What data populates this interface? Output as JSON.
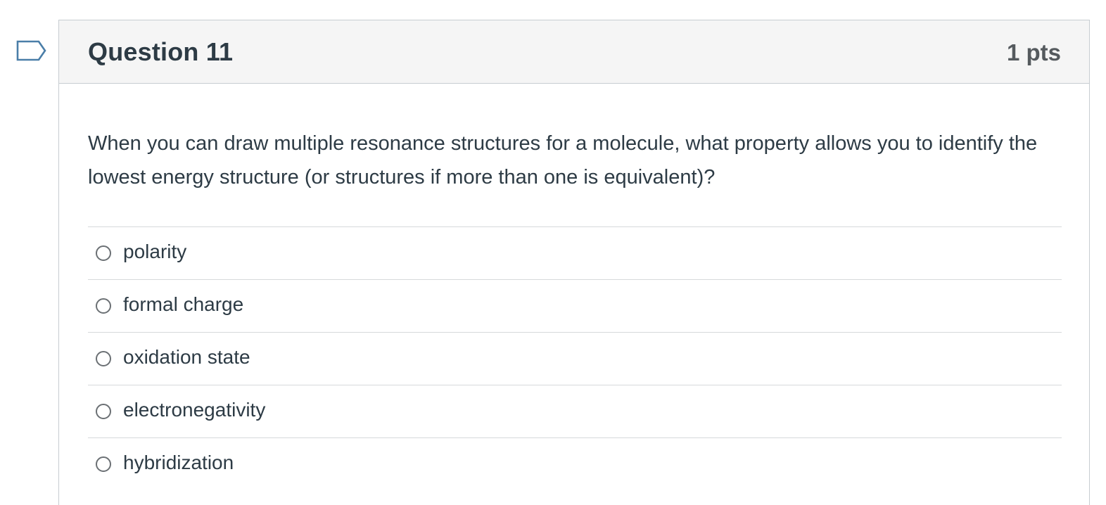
{
  "question": {
    "title": "Question 11",
    "points": "1 pts",
    "text": "When you can draw multiple resonance structures for a molecule, what property allows you to identify the lowest energy structure (or structures if more than one is equivalent)?",
    "flag_icon": "bookmark-flag-icon"
  },
  "answers": [
    {
      "label": "polarity",
      "selected": false
    },
    {
      "label": "formal charge",
      "selected": false
    },
    {
      "label": "oxidation state",
      "selected": false
    },
    {
      "label": "electronegativity",
      "selected": false
    },
    {
      "label": "hybridization",
      "selected": false
    }
  ],
  "colors": {
    "text": "#2d3b45",
    "header_bg": "#f5f5f5",
    "border": "#c7cdd1",
    "flag": "#4a7ea8"
  }
}
